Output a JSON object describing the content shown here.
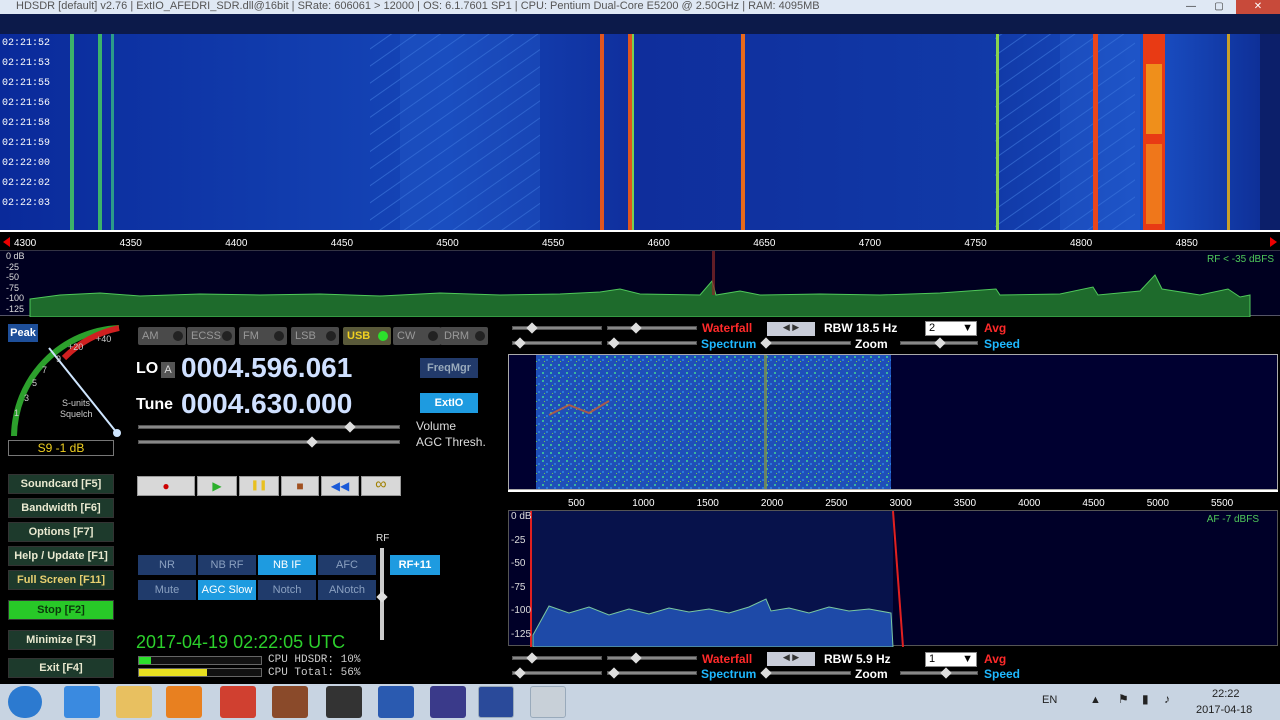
{
  "window": {
    "title": "HDSDR  [default]  v2.76   |  ExtIO_AFEDRI_SDR.dll@16bit  |  SRate: 606061 > 12000  |  OS: 6.1.7601 SP1  |  CPU: Pentium Dual-Core       E5200  @ 2.50GHz  |  RAM: 4095MB",
    "minimize": "—",
    "maximize": "▢",
    "close": "✕"
  },
  "waterfall": {
    "times": [
      "02:21:52",
      "02:21:53",
      "02:21:55",
      "02:21:56",
      "02:21:58",
      "02:21:59",
      "02:22:00",
      "02:22:02",
      "02:22:03"
    ],
    "freq_ticks": [
      "4300",
      "4350",
      "4400",
      "4450",
      "4500",
      "4550",
      "4600",
      "4650",
      "4700",
      "4750",
      "4800",
      "4850"
    ]
  },
  "rf_spectrum": {
    "db_labels": [
      "0 dB",
      "-25",
      "-50",
      "-75",
      "-100",
      "-125"
    ],
    "level_text": "RF < -35 dBFS"
  },
  "smeter": {
    "peak_label": "Peak",
    "scale": [
      "1",
      "3",
      "5",
      "7",
      "9",
      "+20",
      "+40"
    ],
    "caption1": "S-units",
    "caption2": "Squelch",
    "reading": "S9 -1 dB"
  },
  "side_buttons": [
    "Soundcard  [F5]",
    "Bandwidth  [F6]",
    "Options  [F7]",
    "Help / Update  [F1]",
    "Full Screen  [F11]",
    "Stop      [F2]",
    "Minimize  [F3]",
    "Exit      [F4]"
  ],
  "modes": [
    "AM",
    "ECSS",
    "FM",
    "LSB",
    "USB",
    "CW",
    "DRM"
  ],
  "active_mode": "USB",
  "lo": {
    "label": "LO",
    "sub": "A",
    "value": "0004.596.061"
  },
  "tune": {
    "label": "Tune",
    "value": "0004.630.000"
  },
  "freqmgr": "FreqMgr",
  "extio": "ExtIO",
  "sliders": {
    "volume": "Volume",
    "agc": "AGC Thresh."
  },
  "media": {
    "rec": "●",
    "play": "▶",
    "pause": "❚❚",
    "stop": "■",
    "rew": "◀◀",
    "loop": "∞"
  },
  "dsp_row1": [
    "NR",
    "NB RF",
    "NB IF",
    "AFC"
  ],
  "dsp_row2": [
    "Mute",
    "AGC Slow",
    "Notch",
    "ANotch"
  ],
  "rf_label": "RF",
  "rf_gain": "RF+11",
  "datetime": "2017-04-19   02:22:05 UTC",
  "cpu": {
    "hdsdr": "CPU HDSDR: 10%",
    "total": "CPU Total: 56%",
    "hdsdr_pct": 10,
    "total_pct": 56
  },
  "af_controls_top": {
    "waterfall": "Waterfall",
    "spectrum": "Spectrum",
    "rbw": "RBW 18.5 Hz",
    "zoom": "Zoom",
    "select": "2",
    "avg": "Avg",
    "speed": "Speed"
  },
  "af_controls_bottom": {
    "waterfall": "Waterfall",
    "spectrum": "Spectrum",
    "rbw": "RBW  5.9 Hz",
    "zoom": "Zoom",
    "select": "1",
    "avg": "Avg",
    "speed": "Speed"
  },
  "af_ticks": [
    "500",
    "1000",
    "1500",
    "2000",
    "2500",
    "3000",
    "3500",
    "4000",
    "4500",
    "5000",
    "5500"
  ],
  "af_spectrum": {
    "db_labels": [
      "0 dB",
      "-25",
      "-50",
      "-75",
      "-100",
      "-125"
    ],
    "level_text": "AF -7 dBFS"
  },
  "taskbar": {
    "lang": "EN",
    "time": "22:22",
    "date": "2017-04-18"
  }
}
